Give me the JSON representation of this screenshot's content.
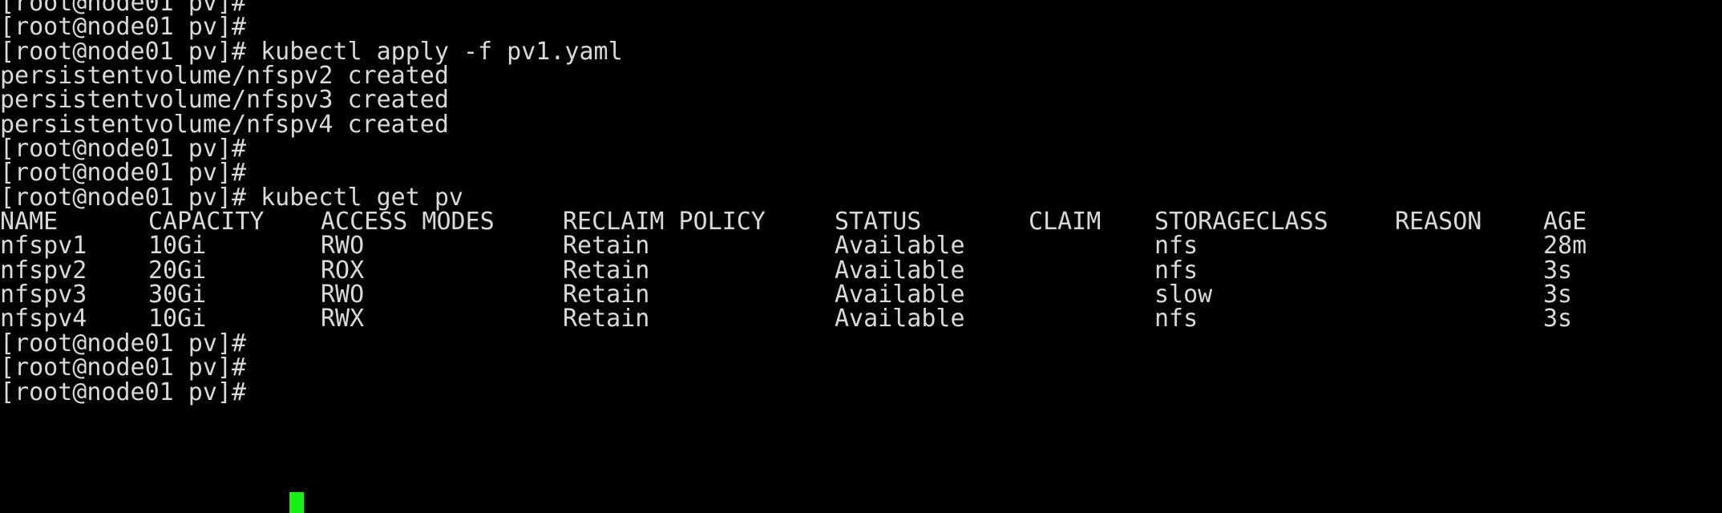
{
  "terminal": {
    "colors": {
      "background": "#000000",
      "foreground": "#d9d9d9",
      "cursor": "#16f016"
    },
    "prompt": "[root@node01 pv]# ",
    "lines": [
      {
        "type": "prompt",
        "text": "[root@node01 pv]# "
      },
      {
        "type": "prompt",
        "text": "[root@node01 pv]# "
      },
      {
        "type": "command",
        "text": "[root@node01 pv]# kubectl apply -f pv1.yaml"
      },
      {
        "type": "output",
        "text": "persistentvolume/nfspv2 created"
      },
      {
        "type": "output",
        "text": "persistentvolume/nfspv3 created"
      },
      {
        "type": "output",
        "text": "persistentvolume/nfspv4 created"
      },
      {
        "type": "prompt",
        "text": "[root@node01 pv]# "
      },
      {
        "type": "prompt",
        "text": "[root@node01 pv]# "
      },
      {
        "type": "command",
        "text": "[root@node01 pv]# kubectl get pv"
      }
    ],
    "trailing_lines": [
      {
        "type": "prompt",
        "text": "[root@node01 pv]# "
      },
      {
        "type": "prompt",
        "text": "[root@node01 pv]# "
      },
      {
        "type": "prompt",
        "text": "[root@node01 pv]# "
      }
    ],
    "commands": {
      "apply": "kubectl apply -f pv1.yaml",
      "get": "kubectl get pv"
    },
    "created_messages": [
      "persistentvolume/nfspv2 created",
      "persistentvolume/nfspv3 created",
      "persistentvolume/nfspv4 created"
    ]
  },
  "pv_table": {
    "headers": {
      "name": "NAME",
      "capacity": "CAPACITY",
      "access_modes": "ACCESS MODES",
      "reclaim_policy": "RECLAIM POLICY",
      "status": "STATUS",
      "claim": "CLAIM",
      "storageclass": "STORAGECLASS",
      "reason": "REASON",
      "age": "AGE"
    },
    "rows": [
      {
        "name": "nfspv1",
        "capacity": "10Gi",
        "access_modes": "RWO",
        "reclaim_policy": "Retain",
        "status": "Available",
        "claim": "",
        "storageclass": "nfs",
        "reason": "",
        "age": "28m"
      },
      {
        "name": "nfspv2",
        "capacity": "20Gi",
        "access_modes": "ROX",
        "reclaim_policy": "Retain",
        "status": "Available",
        "claim": "",
        "storageclass": "nfs",
        "reason": "",
        "age": "3s"
      },
      {
        "name": "nfspv3",
        "capacity": "30Gi",
        "access_modes": "RWO",
        "reclaim_policy": "Retain",
        "status": "Available",
        "claim": "",
        "storageclass": "slow",
        "reason": "",
        "age": "3s"
      },
      {
        "name": "nfspv4",
        "capacity": "10Gi",
        "access_modes": "RWX",
        "reclaim_policy": "Retain",
        "status": "Available",
        "claim": "",
        "storageclass": "nfs",
        "reason": "",
        "age": "3s"
      }
    ]
  }
}
